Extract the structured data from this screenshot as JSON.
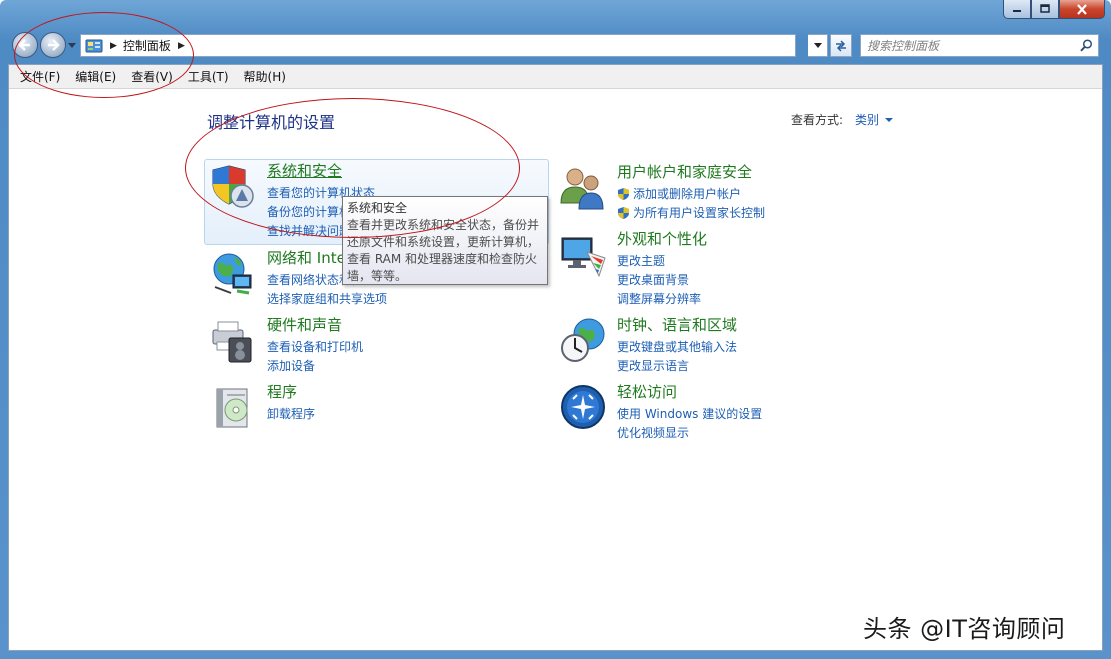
{
  "window": {
    "minimize_icon": "minimize-icon",
    "maximize_icon": "maximize-icon",
    "close_icon": "close-icon"
  },
  "address_bar": {
    "breadcrumb": [
      "控制面板"
    ],
    "search_placeholder": "搜索控制面板"
  },
  "menu": [
    {
      "label": "文件(F)"
    },
    {
      "label": "编辑(E)"
    },
    {
      "label": "查看(V)"
    },
    {
      "label": "工具(T)"
    },
    {
      "label": "帮助(H)"
    }
  ],
  "main": {
    "heading": "调整计算机的设置",
    "view_by_label": "查看方式:",
    "view_by_value": "类别"
  },
  "categories": [
    {
      "title": "系统和安全",
      "icon": "security-shield-icon",
      "links": [
        "查看您的计算机状态",
        "备份您的计算机",
        "查找并解决问题"
      ]
    },
    {
      "title": "网络和 Internet",
      "icon": "network-globe-icon",
      "links": [
        "查看网络状态和任务",
        "选择家庭组和共享选项"
      ]
    },
    {
      "title": "硬件和声音",
      "icon": "printer-speaker-icon",
      "links": [
        "查看设备和打印机",
        "添加设备"
      ]
    },
    {
      "title": "程序",
      "icon": "programs-disc-icon",
      "links": [
        "卸载程序"
      ]
    },
    {
      "title": "用户帐户和家庭安全",
      "icon": "users-icon",
      "links": [
        "添加或删除用户帐户",
        "为所有用户设置家长控制"
      ]
    },
    {
      "title": "外观和个性化",
      "icon": "monitor-palette-icon",
      "links": [
        "更改主题",
        "更改桌面背景",
        "调整屏幕分辨率"
      ]
    },
    {
      "title": "时钟、语言和区域",
      "icon": "clock-globe-icon",
      "links": [
        "更改键盘或其他输入法",
        "更改显示语言"
      ]
    },
    {
      "title": "轻松访问",
      "icon": "ease-of-access-icon",
      "links": [
        "使用 Windows 建议的设置",
        "优化视频显示"
      ]
    }
  ],
  "tooltip": {
    "title": "系统和安全",
    "lines": [
      "查看并更改系统和安全状态，备份并",
      "还原文件和系统设置，更新计算机，",
      "查看 RAM 和处理器速度和检查防火",
      "墙，等等。"
    ]
  },
  "watermark": "头条 @IT咨询顾问",
  "colors": {
    "link": "#1e5fb4",
    "category_title": "#1f7a1f",
    "heading": "#1e3287",
    "annotation": "#c0141b"
  }
}
